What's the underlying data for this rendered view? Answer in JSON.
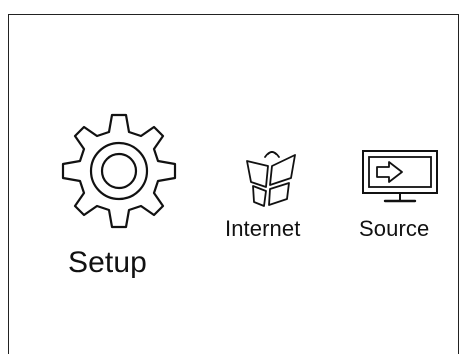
{
  "menu": {
    "items": [
      {
        "label": "Setup",
        "icon": "gear-icon"
      },
      {
        "label": "Internet",
        "icon": "internet-window-icon"
      },
      {
        "label": "Source",
        "icon": "source-monitor-icon"
      }
    ]
  },
  "colors": {
    "background": "#ffffff",
    "foreground": "#111111",
    "frame": "#222222"
  }
}
